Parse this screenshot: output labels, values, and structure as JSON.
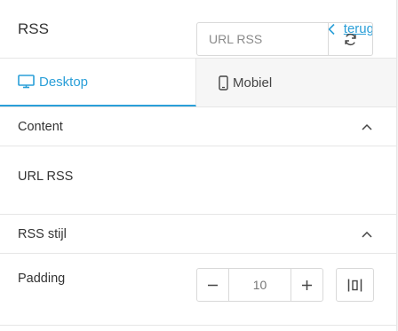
{
  "header": {
    "title": "RSS",
    "back_label": "terug"
  },
  "tabs": [
    {
      "label": "Desktop",
      "icon": "desktop-icon",
      "active": true
    },
    {
      "label": "Mobiel",
      "icon": "mobile-icon",
      "active": false
    }
  ],
  "sections": {
    "content": {
      "title": "Content",
      "url_field": {
        "label": "URL RSS",
        "placeholder": "URL RSS",
        "value": ""
      }
    },
    "style": {
      "title": "RSS stijl",
      "padding": {
        "label": "Padding",
        "value": "10"
      }
    }
  },
  "colors": {
    "accent": "#2a9fd8",
    "border": "#e6e6e6",
    "text": "#333333"
  }
}
